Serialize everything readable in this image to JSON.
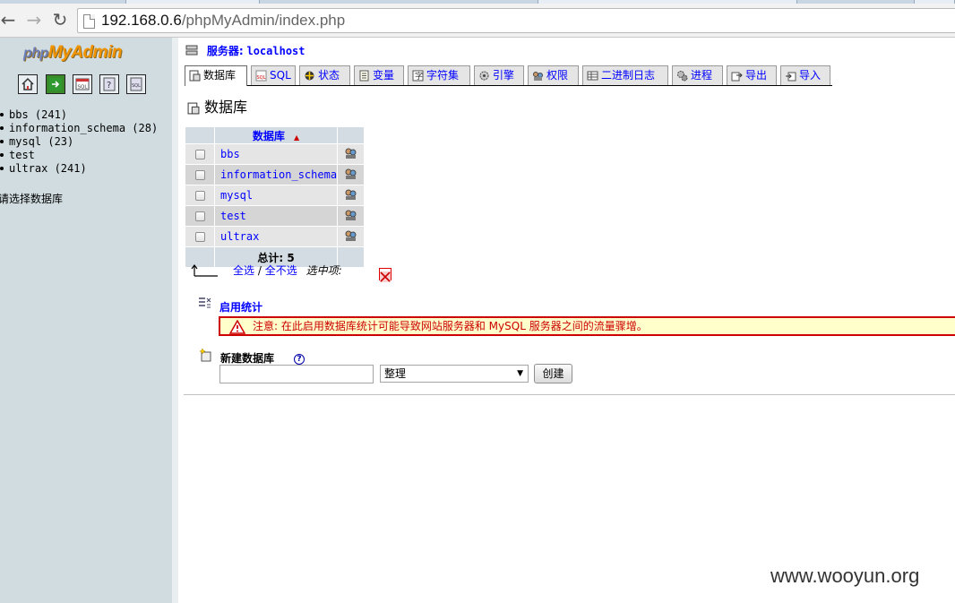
{
  "browser": {
    "url_host": "192.168.0.6",
    "url_path": "/phpMyAdmin/index.php"
  },
  "sidebar": {
    "logo_php": "php",
    "logo_myadmin": "MyAdmin",
    "icons": [
      "home-icon",
      "exit-icon",
      "sql-query-icon",
      "help-icon",
      "sql-docs-icon"
    ],
    "databases": [
      {
        "label": "bbs (241)"
      },
      {
        "label": "information_schema (28)"
      },
      {
        "label": "mysql (23)"
      },
      {
        "label": "test"
      },
      {
        "label": "ultrax (241)"
      }
    ],
    "choose_text": "请选择数据库"
  },
  "main": {
    "server_label": "服务器:",
    "server_value": "localhost",
    "tabs": [
      {
        "label": "数据库"
      },
      {
        "label": "SQL"
      },
      {
        "label": "状态"
      },
      {
        "label": "变量"
      },
      {
        "label": "字符集"
      },
      {
        "label": "引擎"
      },
      {
        "label": "权限"
      },
      {
        "label": "二进制日志"
      },
      {
        "label": "进程"
      },
      {
        "label": "导出"
      },
      {
        "label": "导入"
      }
    ],
    "section_title": "数据库",
    "table": {
      "header": "数据库",
      "rows": [
        {
          "name": "bbs"
        },
        {
          "name": "information_schema"
        },
        {
          "name": "mysql"
        },
        {
          "name": "test"
        },
        {
          "name": "ultrax"
        }
      ],
      "total_label": "总计: 5"
    },
    "select_all": "全选",
    "separator": "/",
    "unselect_all": "全不选",
    "with_selected": "选中项:",
    "stats_title": "启用统计",
    "warning": "注意: 在此启用数据库统计可能导致网站服务器和 MySQL 服务器之间的流量骤增。",
    "new_db_title": "新建数据库",
    "help_glyph": "?",
    "new_db_placeholder": "",
    "collation_value": "整理",
    "create_button": "创建"
  },
  "watermark": "www.wooyun.org",
  "colors": {
    "sidebar_bg": "#d0dce0",
    "link": "#0000ff",
    "header_bg": "#d3dce3",
    "warning_border": "#cc0000",
    "warning_bg": "#ffffcc",
    "logo_orange": "#f29400"
  }
}
